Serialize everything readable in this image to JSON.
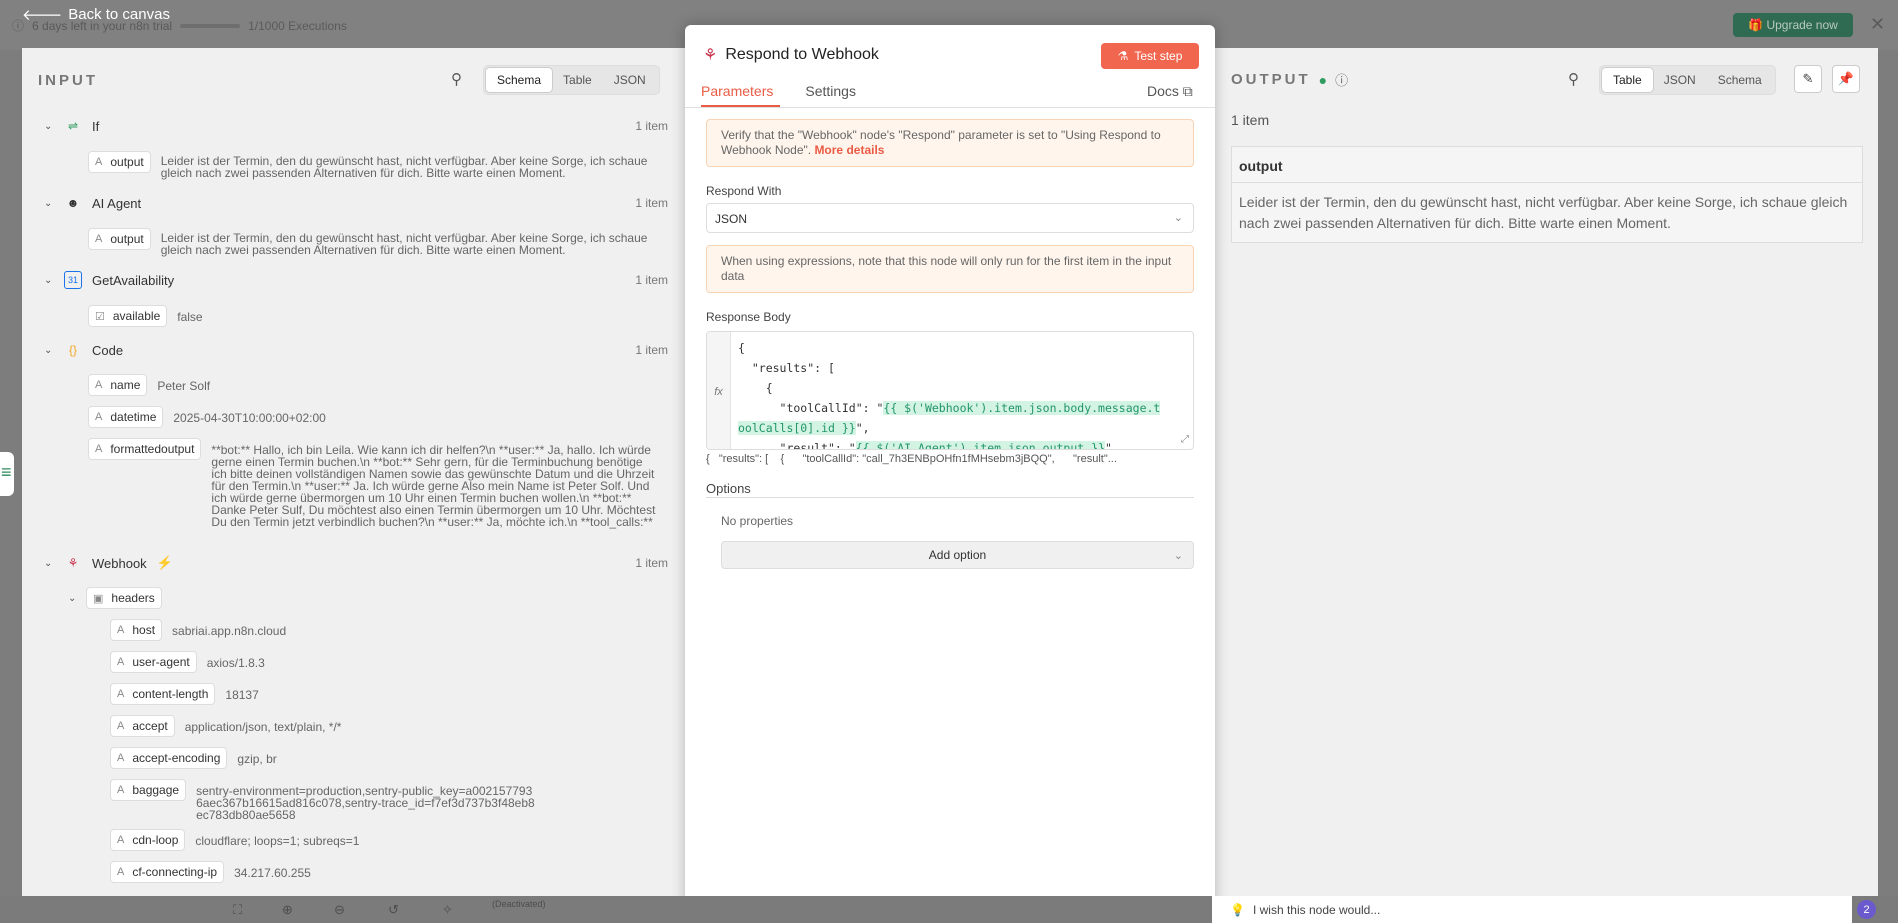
{
  "topbar": {
    "trial": "6 days left in your n8n trial",
    "executions": "1/1000 Executions",
    "upgrade": "Upgrade now",
    "back": "Back to canvas"
  },
  "input": {
    "label": "INPUT",
    "tabs": [
      "Schema",
      "Table",
      "JSON"
    ],
    "nodes": {
      "if": {
        "name": "If",
        "count": "1 item",
        "field": "output",
        "value": "Leider ist der Termin, den du gewünscht hast, nicht verfügbar. Aber keine Sorge, ich schaue gleich nach zwei passenden Alternativen für dich. Bitte warte einen Moment."
      },
      "agent": {
        "name": "AI Agent",
        "count": "1 item",
        "field": "output",
        "value": "Leider ist der Termin, den du gewünscht hast, nicht verfügbar. Aber keine Sorge, ich schaue gleich nach zwei passenden Alternativen für dich. Bitte warte einen Moment."
      },
      "avail": {
        "name": "GetAvailability",
        "count": "1 item",
        "field": "available",
        "value": "false"
      },
      "code": {
        "name": "Code",
        "count": "1 item",
        "f1": "name",
        "v1": "Peter Solf",
        "f2": "datetime",
        "v2": "2025-04-30T10:00:00+02:00",
        "f3": "formattedoutput",
        "v3": "**bot:** Hallo, ich bin Leila. Wie kann ich dir helfen?\\n **user:** Ja, hallo. Ich würde gerne einen Termin buchen.\\n **bot:** Sehr gern, für die Terminbuchung benötige ich bitte deinen vollständigen Namen sowie das gewünschte Datum und die Uhrzeit für den Termin.\\n **user:** Ja. Ich würde gerne Also mein Name ist Peter Solf. Und ich würde gerne übermorgen um 10 Uhr einen Termin buchen wollen.\\n **bot:** Danke Peter Sulf, Du möchtest also einen Termin übermorgen um 10 Uhr. Möchtest Du den Termin jetzt verbindlich buchen?\\n **user:** Ja, möchte ich.\\n **tool_calls:**"
      },
      "webhook": {
        "name": "Webhook",
        "count": "1 item",
        "headers": "headers",
        "rows": [
          {
            "k": "host",
            "v": "sabriai.app.n8n.cloud"
          },
          {
            "k": "user-agent",
            "v": "axios/1.8.3"
          },
          {
            "k": "content-length",
            "v": "18137"
          },
          {
            "k": "accept",
            "v": "application/json, text/plain, */*"
          },
          {
            "k": "accept-encoding",
            "v": "gzip, br"
          },
          {
            "k": "baggage",
            "v": "sentry-environment=production,sentry-public_key=a0021577936aec367b16615ad816c078,sentry-trace_id=f7ef3d737b3f48eb8ec783db80ae5658"
          },
          {
            "k": "cdn-loop",
            "v": "cloudflare; loops=1; subreqs=1"
          },
          {
            "k": "cf-connecting-ip",
            "v": "34.217.60.255"
          }
        ]
      }
    }
  },
  "center": {
    "title": "Respond to Webhook",
    "test_step": "Test step",
    "tab_params": "Parameters",
    "tab_settings": "Settings",
    "docs": "Docs",
    "notice1": "Verify that the \"Webhook\" node's \"Respond\" parameter is set to \"Using Respond to Webhook Node\".",
    "notice1_link": "More details",
    "respond_with_label": "Respond With",
    "respond_with": "JSON",
    "notice2": "When using expressions, note that this node will only run for the first item in the input data",
    "response_body_label": "Response Body",
    "fx": "fx",
    "code": {
      "l1": "{",
      "l2": "  \"results\": [",
      "l3": "    {",
      "l4a": "      \"toolCallId\": \"",
      "l4b": "{{ $('Webhook').item.json.body.message.t",
      "l5a": "oolCalls[0].id }}",
      "l5b": "\",",
      "l6a": "      \"result\": \"",
      "l6b": "{{ $('AI Agent').item.json.output }}",
      "l6c": "\""
    },
    "preview": "{   \"results\": [    {      \"toolCallId\": \"call_7h3ENBpOHfn1fMHsebm3jBQQ\",      \"result\"...",
    "options_label": "Options",
    "no_props": "No properties",
    "add_option": "Add option"
  },
  "output": {
    "label": "OUTPUT",
    "tabs": [
      "Table",
      "JSON",
      "Schema"
    ],
    "count": "1 item",
    "col": "output",
    "value": "Leider ist der Termin, den du gewünscht hast, nicht verfügbar. Aber keine Sorge, ich schaue gleich nach zwei passenden Alternativen für dich. Bitte warte einen Moment."
  },
  "bottom": {
    "wish": "I wish this node would...",
    "badge": "2",
    "deactivated": "(Deactivated)"
  }
}
